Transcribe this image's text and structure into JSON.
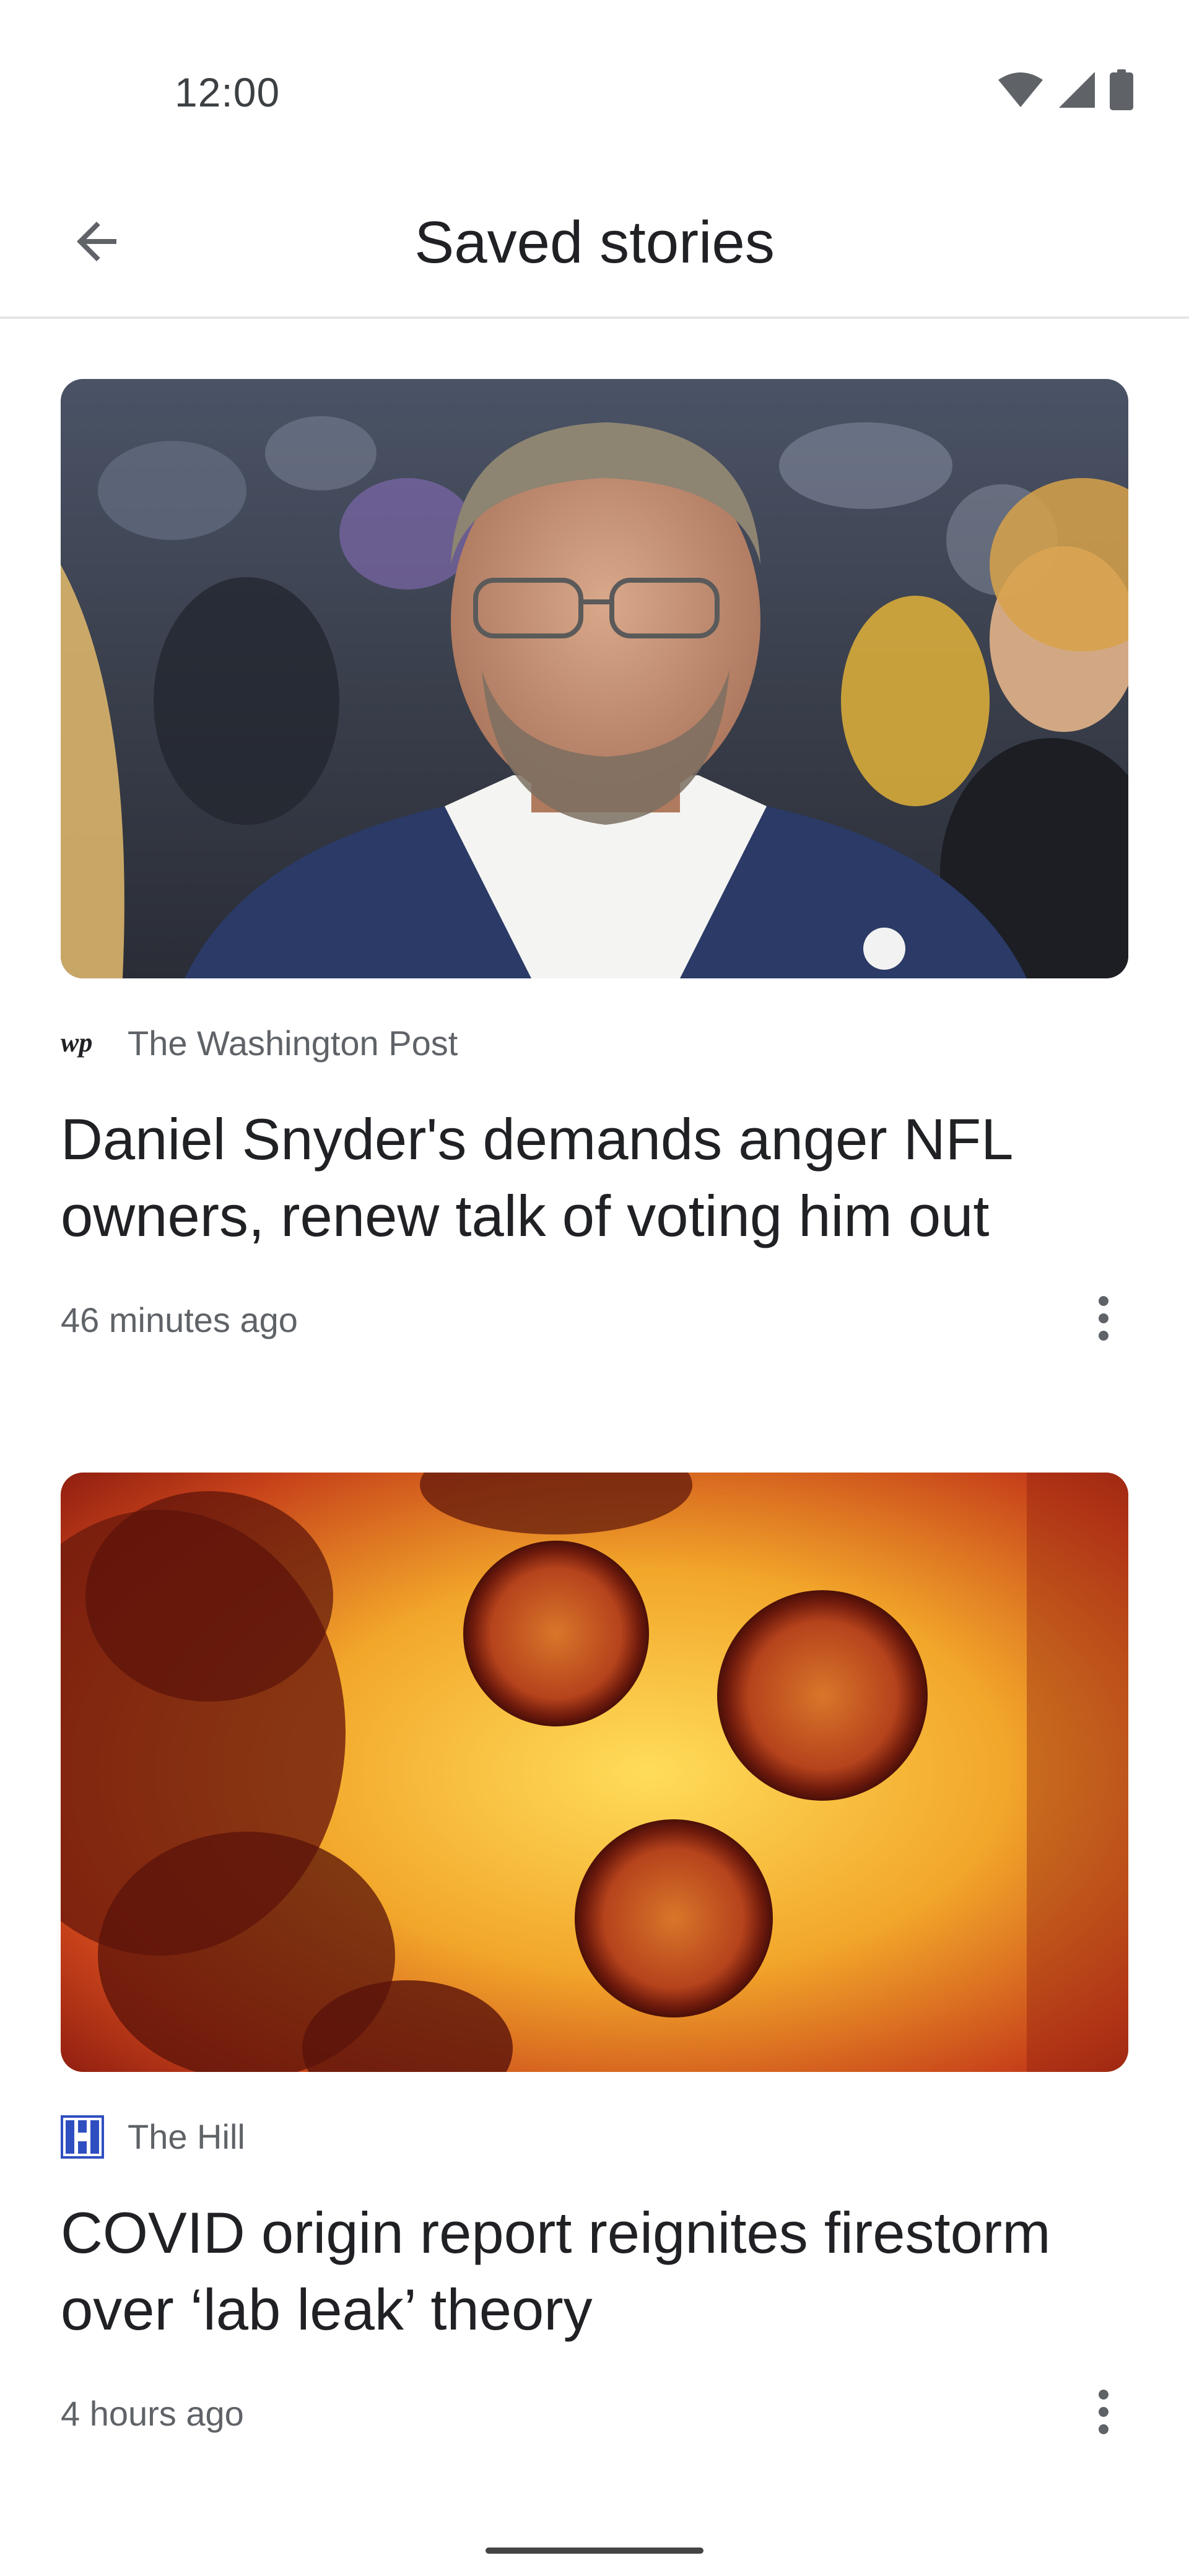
{
  "status_bar": {
    "time": "12:00",
    "icons": [
      "wifi-icon",
      "cellular-signal-icon",
      "battery-icon"
    ]
  },
  "app_bar": {
    "title": "Saved stories",
    "back_icon": "arrow-back-icon"
  },
  "stories": [
    {
      "publisher": "The Washington Post",
      "publisher_logo": "washington-post-logo",
      "headline": "Daniel Snyder's demands anger NFL owners, renew talk of voting him out",
      "timestamp": "46 minutes ago",
      "image": "photo of a man in a navy blazer at a stadium",
      "menu_icon": "more-vert-icon"
    },
    {
      "publisher": "The Hill",
      "publisher_logo": "the-hill-logo",
      "headline": "COVID origin report reignites firestorm over ‘lab leak’ theory",
      "timestamp": "4 hours ago",
      "image": "microscope image of coronavirus particles",
      "menu_icon": "more-vert-icon"
    }
  ],
  "colors": {
    "text_primary": "#202124",
    "text_secondary": "#5f6368",
    "divider": "#e6e6e6",
    "hill_blue": "#2f4fc0"
  }
}
